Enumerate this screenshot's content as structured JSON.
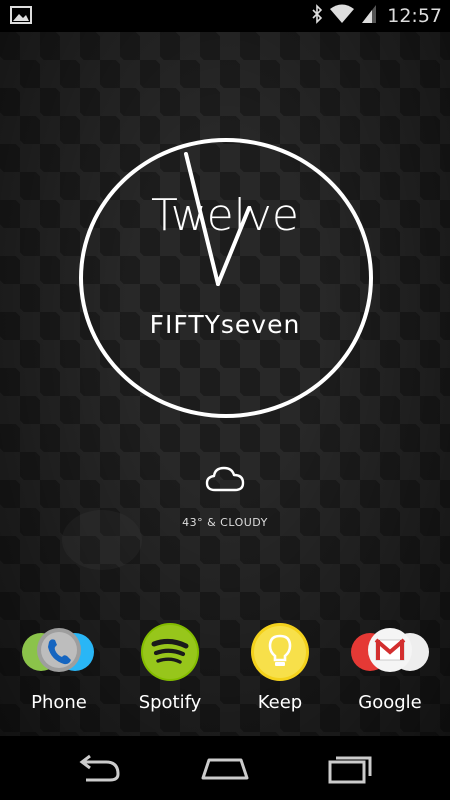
{
  "status_bar": {
    "time": "12:57",
    "icons": [
      "image-notification-icon",
      "bluetooth-icon",
      "wifi-icon",
      "signal-icon"
    ]
  },
  "clock_widget": {
    "hour_word": "Twelve",
    "minute_word": "FIFTYseven",
    "ring_color": "#ffffff"
  },
  "weather": {
    "icon": "cloud-icon",
    "text": "43° & CLOUDY"
  },
  "dock": {
    "items": [
      {
        "label": "Phone",
        "icon": "phone-icon"
      },
      {
        "label": "Spotify",
        "icon": "spotify-icon"
      },
      {
        "label": "Keep",
        "icon": "keep-icon"
      },
      {
        "label": "Google",
        "icon": "google-folder-icon"
      }
    ]
  },
  "nav_bar": {
    "buttons": [
      "back-icon",
      "home-icon",
      "recents-icon"
    ]
  },
  "colors": {
    "spotify_green": "#84bd00",
    "keep_yellow": "#f4d21c",
    "gmail_red": "#d32f2f"
  }
}
